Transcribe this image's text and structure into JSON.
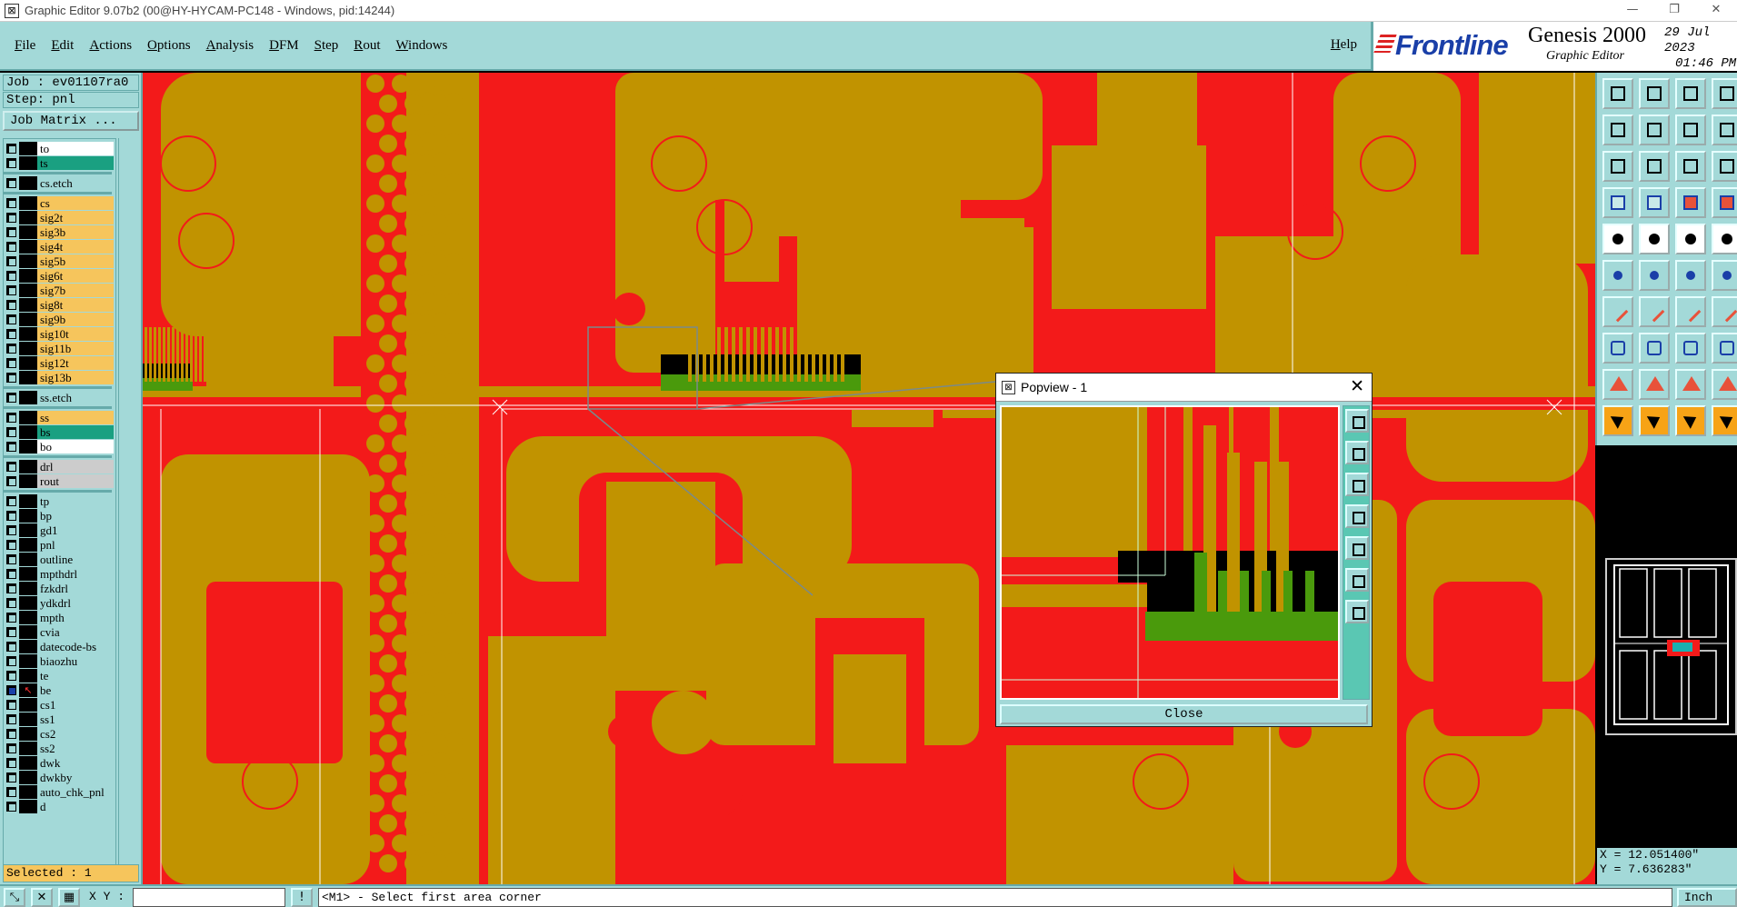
{
  "window": {
    "title": "Graphic Editor 9.07b2 (00@HY-HYCAM-PC148 - Windows, pid:14244)",
    "minimize": "—",
    "restore": "❐",
    "close": "✕"
  },
  "menu": {
    "items": [
      "File",
      "Edit",
      "Actions",
      "Options",
      "Analysis",
      "DFM",
      "Step",
      "Rout",
      "Windows"
    ],
    "help": "Help"
  },
  "brand": {
    "logo": "Frontline",
    "product": "Genesis 2000",
    "subtitle": "Graphic Editor",
    "date": "29 Jul 2023",
    "time": "01:46 PM"
  },
  "job": {
    "job_label": "Job : ev01107ra0",
    "step_label": "Step: pnl",
    "matrix_button": "Job Matrix ..."
  },
  "layers": [
    {
      "name": "to",
      "color": "#ffffff",
      "group": 1
    },
    {
      "name": "ts",
      "color": "#1aa081",
      "group": 1
    },
    {
      "name": "cs.etch",
      "color": "#a3d9d8",
      "group": 2
    },
    {
      "name": "cs",
      "color": "#f6c55c",
      "group": 3
    },
    {
      "name": "sig2t",
      "color": "#f6c55c",
      "group": 3
    },
    {
      "name": "sig3b",
      "color": "#f6c55c",
      "group": 3
    },
    {
      "name": "sig4t",
      "color": "#f6c55c",
      "group": 3
    },
    {
      "name": "sig5b",
      "color": "#f6c55c",
      "group": 3
    },
    {
      "name": "sig6t",
      "color": "#f6c55c",
      "group": 3
    },
    {
      "name": "sig7b",
      "color": "#f6c55c",
      "group": 3
    },
    {
      "name": "sig8t",
      "color": "#f6c55c",
      "group": 3
    },
    {
      "name": "sig9b",
      "color": "#f6c55c",
      "group": 3
    },
    {
      "name": "sig10t",
      "color": "#f6c55c",
      "group": 3
    },
    {
      "name": "sig11b",
      "color": "#f6c55c",
      "group": 3
    },
    {
      "name": "sig12t",
      "color": "#f6c55c",
      "group": 3
    },
    {
      "name": "sig13b",
      "color": "#f6c55c",
      "group": 3
    },
    {
      "name": "ss.etch",
      "color": "#a3d9d8",
      "group": 4
    },
    {
      "name": "ss",
      "color": "#f6c55c",
      "group": 5
    },
    {
      "name": "bs",
      "color": "#1aa081",
      "group": 5
    },
    {
      "name": "bo",
      "color": "#ffffff",
      "group": 5
    },
    {
      "name": "drl",
      "color": "#cccccc",
      "group": 6
    },
    {
      "name": "rout",
      "color": "#cccccc",
      "group": 6
    },
    {
      "name": "tp",
      "color": "#a3d9d8",
      "group": 7
    },
    {
      "name": "bp",
      "color": "#a3d9d8",
      "group": 7
    },
    {
      "name": "gd1",
      "color": "#a3d9d8",
      "group": 7
    },
    {
      "name": "pnl",
      "color": "#a3d9d8",
      "group": 7
    },
    {
      "name": "outline",
      "color": "#a3d9d8",
      "group": 7
    },
    {
      "name": "mpthdrl",
      "color": "#a3d9d8",
      "group": 7
    },
    {
      "name": "fzkdrl",
      "color": "#a3d9d8",
      "group": 7
    },
    {
      "name": "ydkdrl",
      "color": "#a3d9d8",
      "group": 7
    },
    {
      "name": "mpth",
      "color": "#a3d9d8",
      "group": 7
    },
    {
      "name": "cvia",
      "color": "#a3d9d8",
      "group": 7
    },
    {
      "name": "datecode-bs",
      "color": "#a3d9d8",
      "group": 7
    },
    {
      "name": "biaozhu",
      "color": "#a3d9d8",
      "group": 7
    },
    {
      "name": "te",
      "color": "#a3d9d8",
      "group": 7
    },
    {
      "name": "be",
      "color": "#a3d9d8",
      "group": 7,
      "active": true
    },
    {
      "name": "cs1",
      "color": "#a3d9d8",
      "group": 7
    },
    {
      "name": "ss1",
      "color": "#a3d9d8",
      "group": 7
    },
    {
      "name": "cs2",
      "color": "#a3d9d8",
      "group": 7
    },
    {
      "name": "ss2",
      "color": "#a3d9d8",
      "group": 7
    },
    {
      "name": "dwk",
      "color": "#a3d9d8",
      "group": 7
    },
    {
      "name": "dwkby",
      "color": "#a3d9d8",
      "group": 7
    },
    {
      "name": "auto_chk_pnl",
      "color": "#a3d9d8",
      "group": 7
    },
    {
      "name": "d",
      "color": "#a3d9d8",
      "group": 7
    }
  ],
  "selected": "Selected : 1",
  "popview": {
    "title": "Popview - 1",
    "close_icon": "✕",
    "close_button": "Close"
  },
  "coords": {
    "x": "X = 12.051400\"",
    "y": "Y = 7.636283\""
  },
  "status": {
    "xy_label": "X Y :",
    "xy_value": "",
    "message": "<M1> - Select first area corner",
    "unit": "Inch"
  },
  "colors": {
    "copper": "#c19300",
    "base": "#f31a1a",
    "panel": "#a3d9d8",
    "green": "#4a9a0c"
  }
}
